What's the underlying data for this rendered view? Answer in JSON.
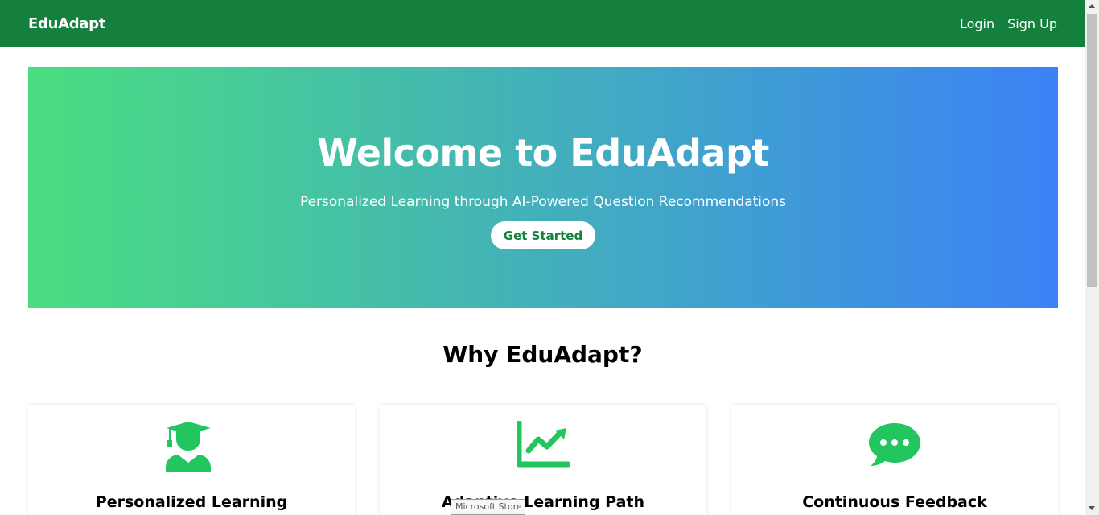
{
  "navbar": {
    "brand": "EduAdapt",
    "links": [
      "Login",
      "Sign Up"
    ]
  },
  "hero": {
    "title": "Welcome to EduAdapt",
    "subtitle": "Personalized Learning through AI-Powered Question Recommendations",
    "cta_label": "Get Started"
  },
  "features": {
    "title": "Why EduAdapt?",
    "cards": [
      {
        "icon": "graduate-icon",
        "title": "Personalized Learning"
      },
      {
        "icon": "chart-line-icon",
        "title": "Adaptive Learning Path"
      },
      {
        "icon": "chat-bubble-icon",
        "title": "Continuous Feedback"
      }
    ]
  },
  "tooltip": "Microsoft Store",
  "colors": {
    "navbar": "#15803d",
    "hero_start": "#4ade80",
    "hero_end": "#3b82f6",
    "icon": "#22c55e"
  }
}
